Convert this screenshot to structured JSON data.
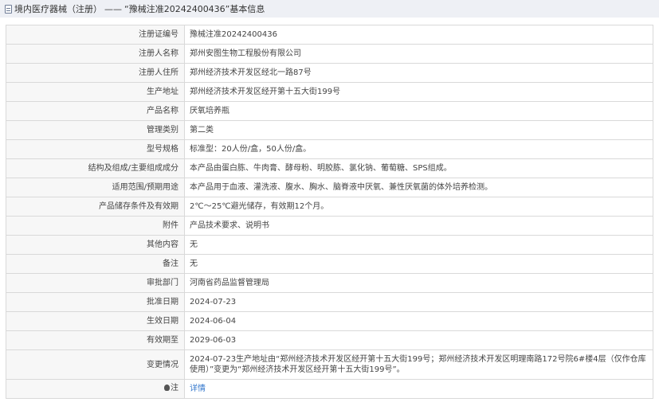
{
  "header": {
    "part1": "境内医疗器械（注册）",
    "separator": "——",
    "part2": "“豫械注准20242400436”基本信息"
  },
  "rows": [
    {
      "label": "注册证编号",
      "value": "豫械注准20242400436"
    },
    {
      "label": "注册人名称",
      "value": "郑州安图生物工程股份有限公司"
    },
    {
      "label": "注册人住所",
      "value": "郑州经济技术开发区经北一路87号"
    },
    {
      "label": "生产地址",
      "value": "郑州经济技术开发区经开第十五大街199号"
    },
    {
      "label": "产品名称",
      "value": "厌氧培养瓶"
    },
    {
      "label": "管理类别",
      "value": "第二类"
    },
    {
      "label": "型号规格",
      "value": "标准型：20人份/盒，50人份/盒。"
    },
    {
      "label": "结构及组成/主要组成成分",
      "value": "本产品由蛋白胨、牛肉膏、酵母粉、明胶胨、氯化钠、葡萄糖、SPS组成。"
    },
    {
      "label": "适用范围/预期用途",
      "value": "本产品用于血液、灌洗液、腹水、胸水、脑脊液中厌氧、兼性厌氧菌的体外培养检测。"
    },
    {
      "label": "产品储存条件及有效期",
      "value": "2℃～25℃避光储存，有效期12个月。"
    },
    {
      "label": "附件",
      "value": "产品技术要求、说明书"
    },
    {
      "label": "其他内容",
      "value": "无"
    },
    {
      "label": "备注",
      "value": "无"
    },
    {
      "label": "审批部门",
      "value": "河南省药品监督管理局"
    },
    {
      "label": "批准日期",
      "value": "2024-07-23"
    },
    {
      "label": "生效日期",
      "value": "2024-06-04"
    },
    {
      "label": "有效期至",
      "value": "2029-06-03"
    },
    {
      "label": "变更情况",
      "value": "2024-07-23生产地址由“郑州经济技术开发区经开第十五大街199号；郑州经济技术开发区明理南路172号院6#楼4层（仅作仓库使用）”变更为“郑州经济技术开发区经开第十五大街199号”。"
    }
  ],
  "note": {
    "label": "注",
    "icon": "bulb-icon",
    "link": "详情"
  },
  "colors": {
    "header_bg": "#eef0f5",
    "label_bg": "#f7f7f7",
    "border": "#d9d9d9",
    "link": "#3377cc"
  }
}
